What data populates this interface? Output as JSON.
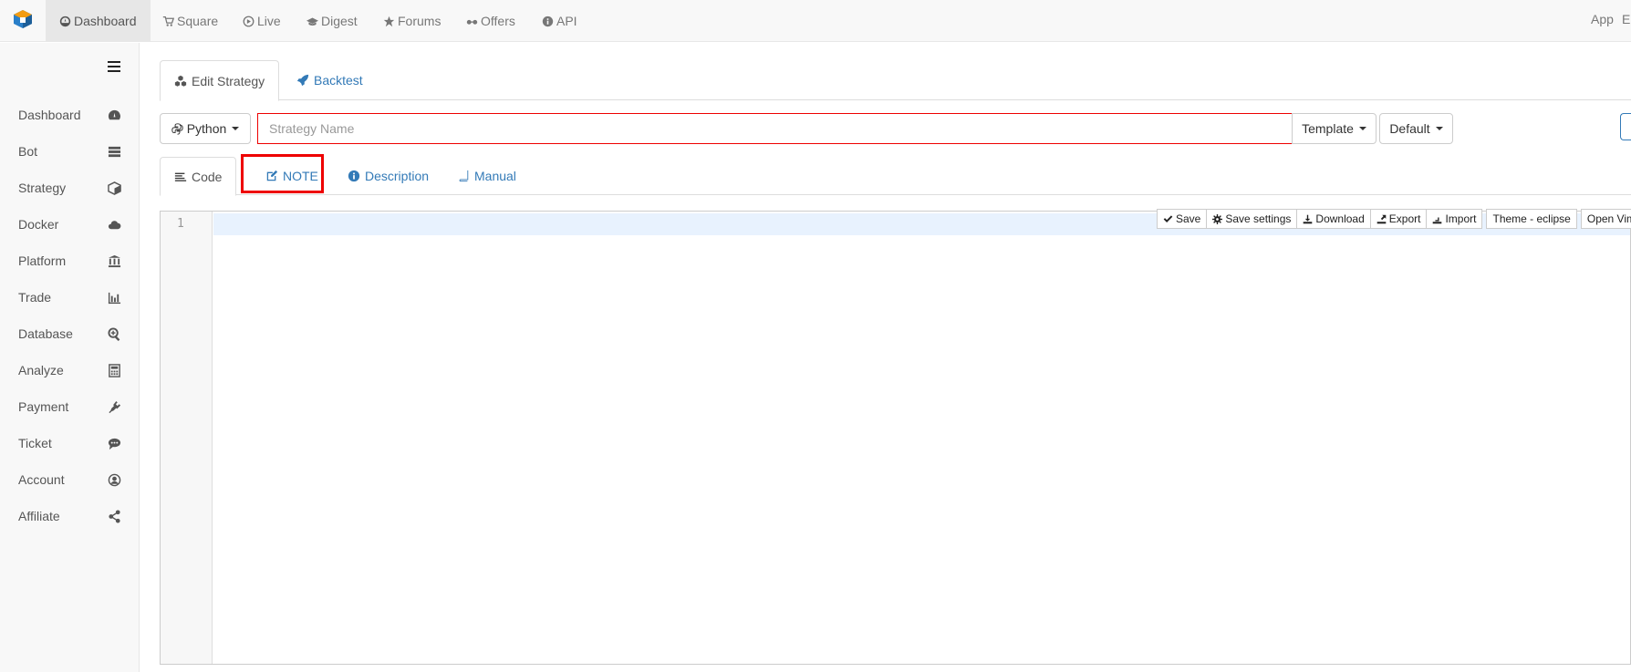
{
  "topnav": {
    "items": [
      {
        "label": "Dashboard",
        "icon": "dashboard-icon"
      },
      {
        "label": "Square",
        "icon": "cart-icon"
      },
      {
        "label": "Live",
        "icon": "play-circle-icon"
      },
      {
        "label": "Digest",
        "icon": "graduation-cap-icon"
      },
      {
        "label": "Forums",
        "icon": "star-icon"
      },
      {
        "label": "Offers",
        "icon": "glasses-icon"
      },
      {
        "label": "API",
        "icon": "info-circle-icon"
      }
    ],
    "right": [
      "App",
      "E"
    ]
  },
  "sidebar": {
    "items": [
      {
        "label": "Dashboard",
        "icon": "tachometer-icon"
      },
      {
        "label": "Bot",
        "icon": "server-icon"
      },
      {
        "label": "Strategy",
        "icon": "cube-icon"
      },
      {
        "label": "Docker",
        "icon": "cloud-icon"
      },
      {
        "label": "Platform",
        "icon": "bank-icon"
      },
      {
        "label": "Trade",
        "icon": "bar-chart-icon"
      },
      {
        "label": "Database",
        "icon": "search-plus-icon"
      },
      {
        "label": "Analyze",
        "icon": "calculator-icon"
      },
      {
        "label": "Payment",
        "icon": "plug-icon"
      },
      {
        "label": "Ticket",
        "icon": "comment-icon"
      },
      {
        "label": "Account",
        "icon": "user-circle-icon"
      },
      {
        "label": "Affiliate",
        "icon": "share-icon"
      }
    ]
  },
  "main": {
    "tabs": [
      {
        "label": "Edit Strategy",
        "icon": "cubes-icon"
      },
      {
        "label": "Backtest",
        "icon": "rocket-icon"
      }
    ],
    "language_label": "Python",
    "name_placeholder": "Strategy Name",
    "template_label": "Template",
    "default_label": "Default",
    "subtabs": [
      {
        "label": "Code",
        "icon": "align-left-icon"
      },
      {
        "label": "NOTE",
        "icon": "edit-icon"
      },
      {
        "label": "Description",
        "icon": "info-circle-icon"
      },
      {
        "label": "Manual",
        "icon": "book-icon"
      }
    ]
  },
  "editor": {
    "line_number": "1",
    "toolbar": [
      "Save",
      "Save settings",
      "Download",
      "Export",
      "Import",
      "Theme - eclipse",
      "Open Vim"
    ]
  },
  "colors": {
    "accent": "#337ab7",
    "highlight": "#e00000"
  }
}
